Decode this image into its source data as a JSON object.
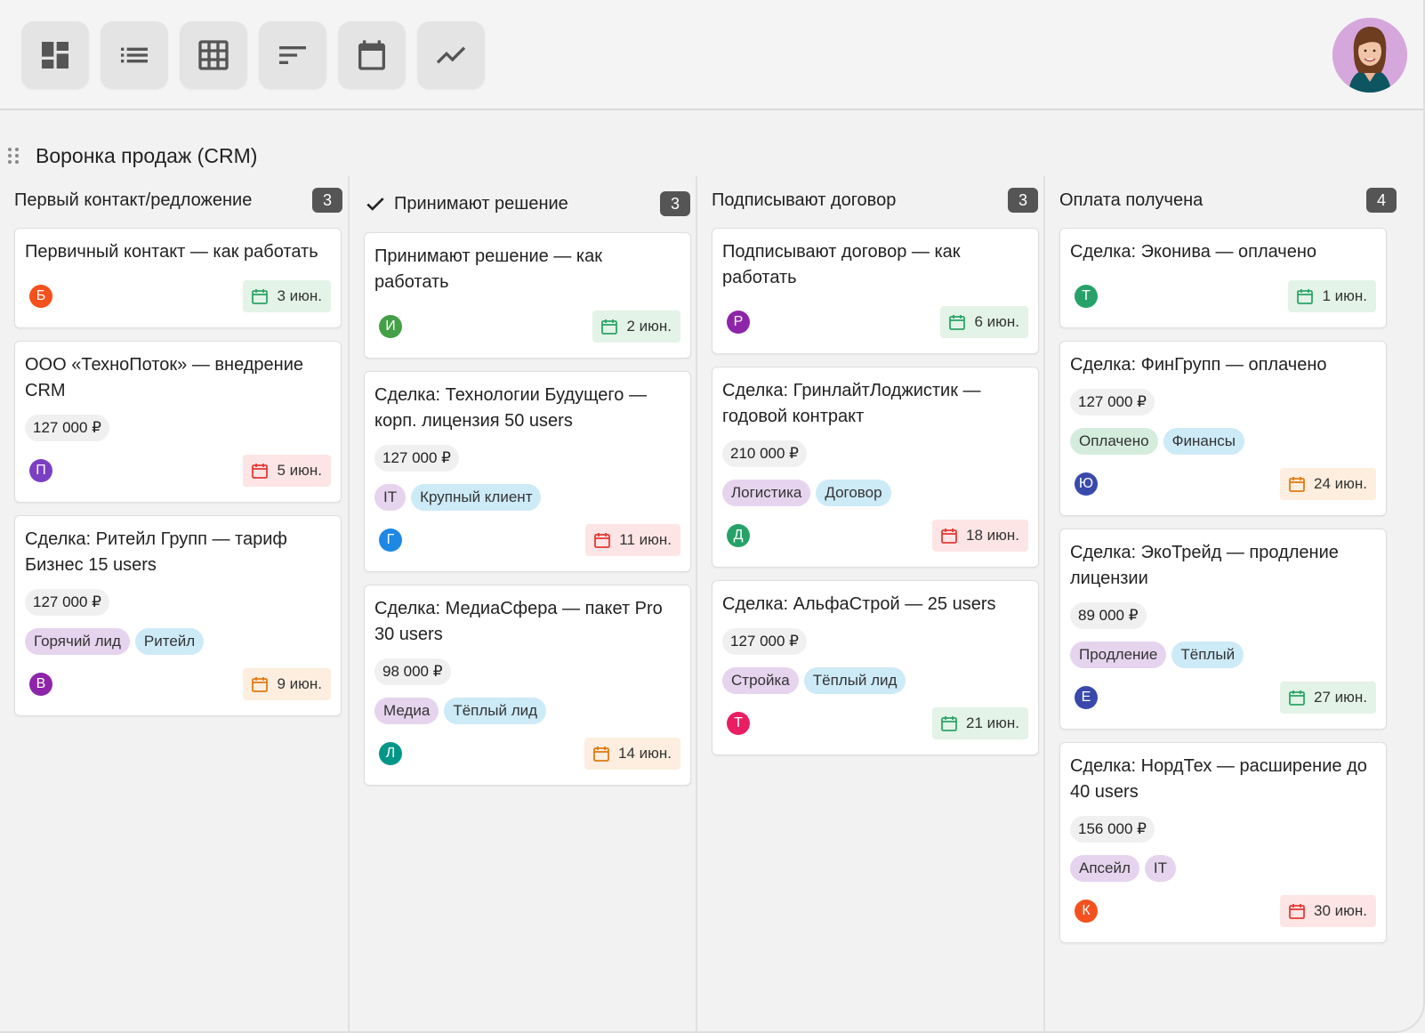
{
  "toolbar": {
    "buttons": [
      {
        "name": "board-view-button",
        "icon": "dashboard-icon"
      },
      {
        "name": "list-view-button",
        "icon": "list-icon"
      },
      {
        "name": "table-view-button",
        "icon": "grid-icon"
      },
      {
        "name": "gantt-view-button",
        "icon": "sort-icon"
      },
      {
        "name": "calendar-view-button",
        "icon": "calendar-icon"
      },
      {
        "name": "chart-view-button",
        "icon": "trend-icon"
      }
    ]
  },
  "board": {
    "title": "Воронка продаж (CRM)"
  },
  "colors": {
    "avatar": {
      "orange": "#f4511e",
      "purple": "#7b3fc4",
      "darkpurple": "#8e24aa",
      "green": "#43a047",
      "blue": "#1e88e5",
      "teal": "#009688",
      "emerald": "#26a269",
      "pink": "#e91e63",
      "navy": "#3949ab"
    },
    "date": {
      "green": "#2ba567",
      "red": "#e53935",
      "orange": "#e07b12"
    }
  },
  "columns": [
    {
      "title": "Первый контакт/редложение",
      "count": "3",
      "checked": false,
      "cards": [
        {
          "title": "Первичный контакт — как работать",
          "avatar": "Б",
          "avatar_color": "orange",
          "date": "3 июн.",
          "date_status": "green"
        },
        {
          "title": "ООО «ТехноПоток» — внедрение CRM",
          "price": "127 000 ₽",
          "avatar": "П",
          "avatar_color": "purple",
          "date": "5 июн.",
          "date_status": "red"
        },
        {
          "title": "Сделка: Ритейл Групп — тариф Бизнес 15 users",
          "price": "127 000 ₽",
          "tags": [
            {
              "label": "Горячий лид",
              "color": "purple"
            },
            {
              "label": "Ритейл",
              "color": "blue"
            }
          ],
          "avatar": "В",
          "avatar_color": "darkpurple",
          "date": "9 июн.",
          "date_status": "orange"
        }
      ]
    },
    {
      "title": "Принимают решение",
      "count": "3",
      "checked": true,
      "cards": [
        {
          "title": "Принимают решение — как работать",
          "avatar": "И",
          "avatar_color": "green",
          "date": "2 июн.",
          "date_status": "green"
        },
        {
          "title": "Сделка: Технологии Будущего — корп. лицензия 50 users",
          "price": "127 000 ₽",
          "tags": [
            {
              "label": "IT",
              "color": "purple"
            },
            {
              "label": "Крупный клиент",
              "color": "blue"
            }
          ],
          "avatar": "Г",
          "avatar_color": "blue",
          "date": "11 июн.",
          "date_status": "red"
        },
        {
          "title": "Сделка: МедиаСфера — пакет Pro 30 users",
          "price": "98 000 ₽",
          "tags": [
            {
              "label": "Медиа",
              "color": "purple"
            },
            {
              "label": "Тёплый лид",
              "color": "blue"
            }
          ],
          "avatar": "Л",
          "avatar_color": "teal",
          "date": "14 июн.",
          "date_status": "orange"
        }
      ]
    },
    {
      "title": "Подписывают договор",
      "count": "3",
      "checked": false,
      "cards": [
        {
          "title": "Подписывают договор — как работать",
          "avatar": "Р",
          "avatar_color": "darkpurple",
          "date": "6 июн.",
          "date_status": "green"
        },
        {
          "title": "Сделка: ГринлайтЛоджистик — годовой контракт",
          "price": "210 000 ₽",
          "tags": [
            {
              "label": "Логистика",
              "color": "purple"
            },
            {
              "label": "Договор",
              "color": "blue"
            }
          ],
          "avatar": "Д",
          "avatar_color": "emerald",
          "date": "18 июн.",
          "date_status": "red"
        },
        {
          "title": "Сделка: АльфаСтрой — 25 users",
          "price": "127 000 ₽",
          "tags": [
            {
              "label": "Стройка",
              "color": "purple"
            },
            {
              "label": "Тёплый лид",
              "color": "blue"
            }
          ],
          "avatar": "Т",
          "avatar_color": "pink",
          "date": "21 июн.",
          "date_status": "green"
        }
      ]
    },
    {
      "title": "Оплата получена",
      "count": "4",
      "checked": false,
      "cards": [
        {
          "title": "Сделка: Эконива — оплачено",
          "avatar": "Т",
          "avatar_color": "emerald",
          "date": "1 июн.",
          "date_status": "green"
        },
        {
          "title": "Сделка: ФинГрупп — оплачено",
          "price": "127 000 ₽",
          "tags": [
            {
              "label": "Оплачено",
              "color": "green"
            },
            {
              "label": "Финансы",
              "color": "blue"
            }
          ],
          "avatar": "Ю",
          "avatar_color": "navy",
          "date": "24 июн.",
          "date_status": "orange"
        },
        {
          "title": "Сделка: ЭкоТрейд — продление лицензии",
          "price": "89 000 ₽",
          "tags": [
            {
              "label": "Продление",
              "color": "purple"
            },
            {
              "label": "Тёплый",
              "color": "blue"
            }
          ],
          "avatar": "Е",
          "avatar_color": "navy",
          "date": "27 июн.",
          "date_status": "green"
        },
        {
          "title": "Сделка: НордТех — расширение до 40 users",
          "price": "156 000 ₽",
          "tags": [
            {
              "label": "Апсейл",
              "color": "purple"
            },
            {
              "label": "IT",
              "color": "purple"
            }
          ],
          "avatar": "К",
          "avatar_color": "orange",
          "date": "30 июн.",
          "date_status": "red"
        }
      ]
    }
  ]
}
